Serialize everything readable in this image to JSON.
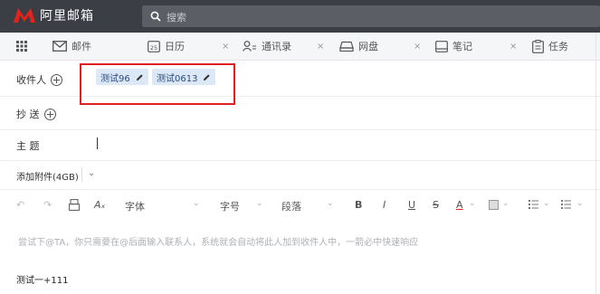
{
  "app": {
    "logo_text": "阿里邮箱"
  },
  "search": {
    "placeholder": "搜索"
  },
  "tabs": [
    {
      "label": "邮件",
      "icon": "mail-icon"
    },
    {
      "label": "日历",
      "icon": "calendar-icon",
      "calendar_day": "25",
      "closable": true
    },
    {
      "label": "通讯录",
      "icon": "contacts-icon",
      "closable": true
    },
    {
      "label": "网盘",
      "icon": "cloud-drive-icon",
      "closable": true
    },
    {
      "label": "笔记",
      "icon": "note-icon",
      "closable": true
    },
    {
      "label": "任务",
      "icon": "task-icon"
    }
  ],
  "close_glyph": "×",
  "compose": {
    "to_label": "收件人",
    "recipients": [
      "测试96",
      "测试0613"
    ],
    "cc_label": "抄 送",
    "subject_label": "主 题",
    "attachment_label": "添加附件(4GB)",
    "attachment_caret": "⌄"
  },
  "toolbar": {
    "font_label": "字体",
    "size_label": "字号",
    "paragraph_label": "段落",
    "bold": "B",
    "italic": "I",
    "underline": "U",
    "strike": "S",
    "font_color": "A",
    "caret": "⌄"
  },
  "editor": {
    "placeholder": "尝试下@TA，你只需要在@后面输入联系人，系统就会自动将此人加到收件人中，一箭必中快速响应",
    "body_text": "测试一+111"
  },
  "colors": {
    "topbar": "#3b3e44",
    "logo_red": "#e2231a",
    "chip_bg": "#dde8f6",
    "highlight": "#e02020"
  }
}
